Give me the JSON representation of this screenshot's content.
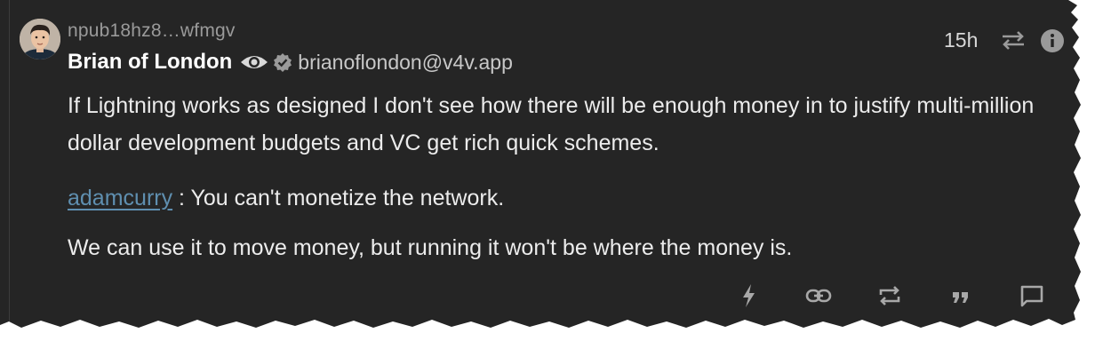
{
  "note": {
    "author": {
      "npub": "npub18hz8…wfmgv",
      "display_name": "Brian of London",
      "nip05": "brianoflondon@v4v.app"
    },
    "time_ago": "15h",
    "content": {
      "paragraph1": "If Lightning works as designed I don't see how there will be enough money in to justify multi-million dollar development budgets and VC get rich quick schemes.",
      "mention": "adamcurry",
      "paragraph2_rest": " : You can't monetize the network.",
      "paragraph3": "We can use it to move money, but running it won't be where the money is."
    },
    "actions": [
      "zap-icon",
      "link-icon",
      "repost-icon",
      "quote-icon",
      "reply-icon"
    ]
  },
  "colors": {
    "card_bg": "#252525",
    "text": "#ececec",
    "muted": "#9a9a9a",
    "mention": "#5f8fb0"
  }
}
